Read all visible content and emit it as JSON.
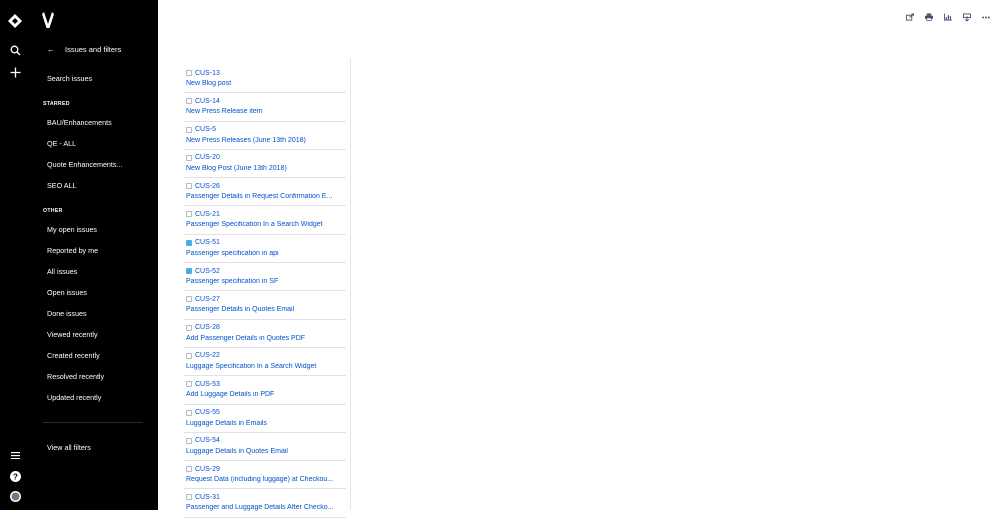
{
  "global_nav": {
    "icons": [
      "jira-logo-icon",
      "search-icon",
      "plus-icon",
      "menu-icon",
      "help-icon",
      "avatar"
    ]
  },
  "side_panel": {
    "back_label": "Issues and filters",
    "search_label": "Search issues",
    "starred_heading": "STARRED",
    "starred": [
      "BAU/Enhancements",
      "QE - ALL",
      "Quote Enhancements...",
      "SEO ALL"
    ],
    "other_heading": "OTHER",
    "other": [
      "My open issues",
      "Reported by me",
      "All issues",
      "Open issues",
      "Done issues",
      "Viewed recently",
      "Created recently",
      "Resolved recently",
      "Updated recently"
    ],
    "view_all_label": "View all filters"
  },
  "toolbar": {
    "icons": [
      "share-icon",
      "print-icon",
      "chart-icon",
      "export-icon",
      "more-icon"
    ]
  },
  "colors": {
    "link": "#0052cc",
    "task": "#b3bac5",
    "story": "#4bade8"
  },
  "issues": [
    {
      "key": "CUS-13",
      "summary": "New Blog post",
      "type": "task"
    },
    {
      "key": "CUS-14",
      "summary": "New Press Release item",
      "type": "task"
    },
    {
      "key": "CUS-5",
      "summary": "New Press Releases (June 13th 2018)",
      "type": "task"
    },
    {
      "key": "CUS-20",
      "summary": "New Blog Post (June 13th 2018)",
      "type": "task"
    },
    {
      "key": "CUS-26",
      "summary": "Passenger Details in Request Confirmation E...",
      "type": "task"
    },
    {
      "key": "CUS-21",
      "summary": "Passenger Specification In a Search Widget",
      "type": "task"
    },
    {
      "key": "CUS-51",
      "summary": "Passenger specification in api",
      "type": "story"
    },
    {
      "key": "CUS-52",
      "summary": "Passenger specification in SF",
      "type": "story"
    },
    {
      "key": "CUS-27",
      "summary": "Passenger Details in Quotes Email",
      "type": "task"
    },
    {
      "key": "CUS-28",
      "summary": "Add Passenger Details in Quotes PDF",
      "type": "task"
    },
    {
      "key": "CUS-22",
      "summary": "Luggage Specification In a Search Widget",
      "type": "task"
    },
    {
      "key": "CUS-53",
      "summary": "Add Luggage Details in PDF",
      "type": "task"
    },
    {
      "key": "CUS-55",
      "summary": "Luggage Details in Emails",
      "type": "task"
    },
    {
      "key": "CUS-54",
      "summary": "Luggage Details in Quotes Email",
      "type": "task"
    },
    {
      "key": "CUS-29",
      "summary": "Request Data (including luggage) at Checkou...",
      "type": "task"
    },
    {
      "key": "CUS-31",
      "summary": "Passenger and Luggage Details After Checko...",
      "type": "task"
    }
  ]
}
